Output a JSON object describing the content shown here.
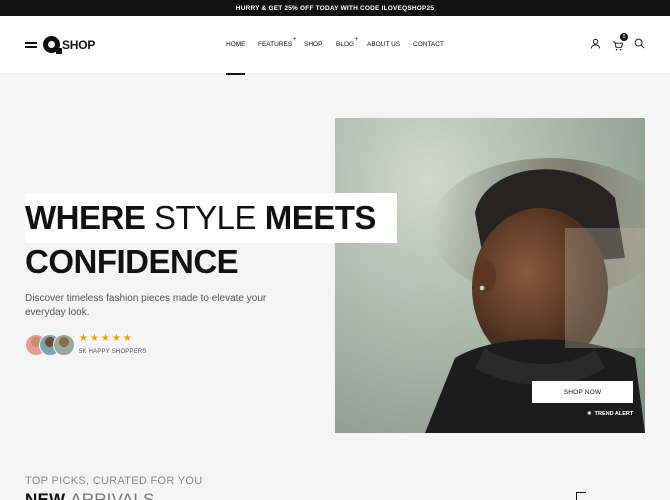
{
  "promo": {
    "text": "HURRY & GET 25% OFF TODAY WITH CODE ILOVEQSHOP25"
  },
  "brand": {
    "name": "SHOP"
  },
  "nav": {
    "items": [
      {
        "label": "HOME"
      },
      {
        "label": "FEATURES",
        "plus": "+"
      },
      {
        "label": "SHOP"
      },
      {
        "label": "BLOG",
        "plus": "+"
      },
      {
        "label": "ABOUT US"
      },
      {
        "label": "CONTACT"
      }
    ]
  },
  "cart": {
    "count": "0"
  },
  "icons": {
    "menu": "hamburger-icon",
    "user": "user-icon",
    "cart": "cart-icon",
    "search": "search-icon",
    "star": "star-icon",
    "sparkle": "sparkle-icon"
  },
  "hero": {
    "title_bold_1": "WHERE ",
    "title_light": "STYLE",
    "title_bold_2": " MEETS",
    "title_line2": "CONFIDENCE",
    "description": "Discover timeless fashion pieces made to elevate your everyday look.",
    "stars": "★★★★★",
    "shoppers": "5K HAPPY SHOPPERS",
    "shop_button": "SHOP NOW",
    "trend_alert": "TREND ALERT"
  },
  "section": {
    "subtitle": "TOP PICKS, CURATED FOR YOU",
    "title_bold": "NEW ",
    "title_light": "ARRIVALS"
  },
  "colors": {
    "accent": "#111111",
    "star": "#e2a70a",
    "background": "#f5f5f5"
  }
}
